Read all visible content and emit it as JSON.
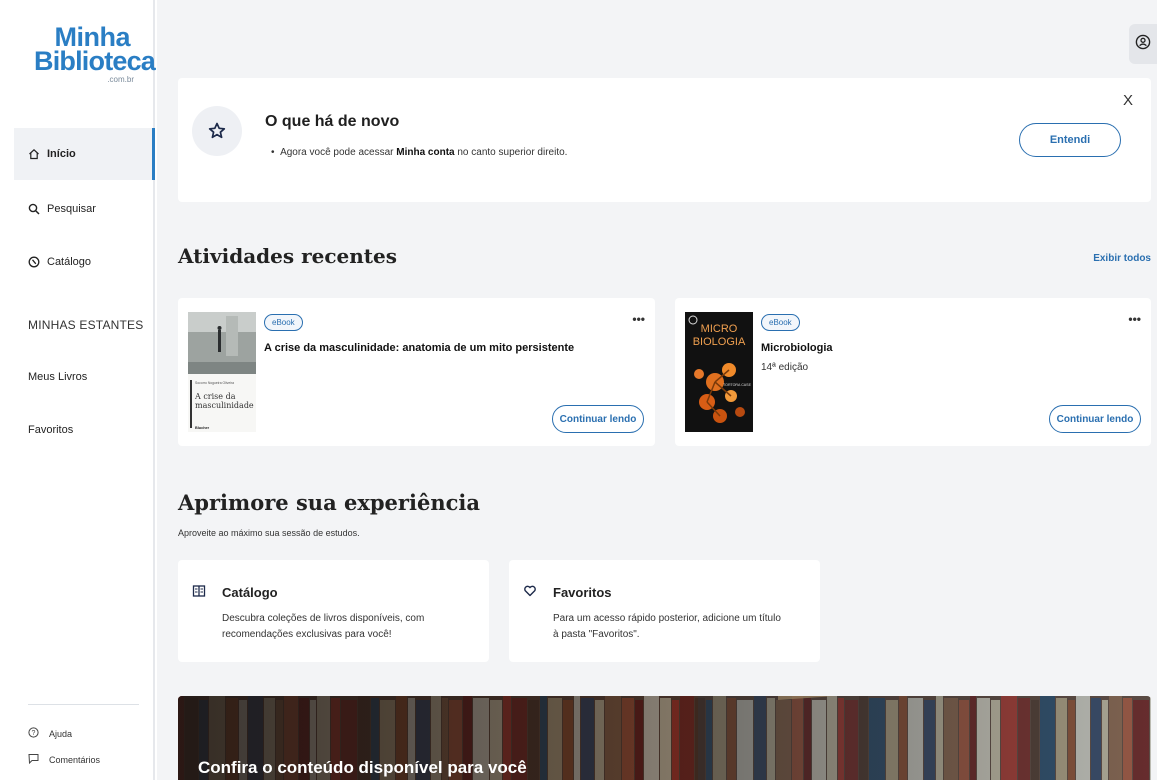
{
  "logo": {
    "line1": "Minha",
    "line2": "Biblioteca",
    "line3": ".com.br"
  },
  "sidebar": {
    "items": [
      {
        "label": "Início",
        "icon": "home-icon"
      },
      {
        "label": "Pesquisar",
        "icon": "search-icon"
      },
      {
        "label": "Catálogo",
        "icon": "compass-icon"
      }
    ],
    "shelves_title": "MINHAS ESTANTES",
    "shelves": [
      {
        "label": "Meus Livros"
      },
      {
        "label": "Favoritos"
      }
    ],
    "footer": [
      {
        "label": "Ajuda",
        "icon": "help-icon"
      },
      {
        "label": "Comentários",
        "icon": "comment-icon"
      }
    ]
  },
  "news": {
    "title": "O que há de novo",
    "bullet_prefix": "Agora você pode acessar ",
    "bullet_bold": "Minha conta",
    "bullet_suffix": " no canto superior direito.",
    "button": "Entendi",
    "close": "X"
  },
  "recent": {
    "title": "Atividades recentes",
    "see_all": "Exibir todos",
    "items": [
      {
        "badge": "eBook",
        "title": "A crise da masculinidade: anatomia de um mito persistente",
        "subtitle": "",
        "button": "Continuar lendo",
        "cover": {
          "author": "Socorro Nogueira Oliveira",
          "title_line1": "A crise da",
          "title_line2": "masculinidade",
          "publisher": "Blucher"
        }
      },
      {
        "badge": "eBook",
        "title": "Microbiologia",
        "subtitle": "14ª edição",
        "button": "Continuar lendo",
        "cover": {
          "title_line1": "MICRO",
          "title_line2": "BIOLOGIA",
          "authors": "TORTORA CASE"
        }
      }
    ],
    "menu": "•••"
  },
  "improve": {
    "title": "Aprimore sua experiência",
    "subtitle": "Aproveite ao máximo sua sessão de estudos.",
    "cards": [
      {
        "title": "Catálogo",
        "desc": "Descubra coleções de livros disponíveis, com recomendações exclusivas para você!",
        "icon": "book-open-icon"
      },
      {
        "title": "Favoritos",
        "desc": "Para um acesso rápido posterior, adicione um título à pasta \"Favoritos\".",
        "icon": "heart-icon"
      }
    ]
  },
  "banner": {
    "title": "Confira o conteúdo disponível para você"
  },
  "colors": {
    "accent": "#2a6fb0",
    "logo": "#2a7ec4",
    "background": "#f3f4f6"
  }
}
